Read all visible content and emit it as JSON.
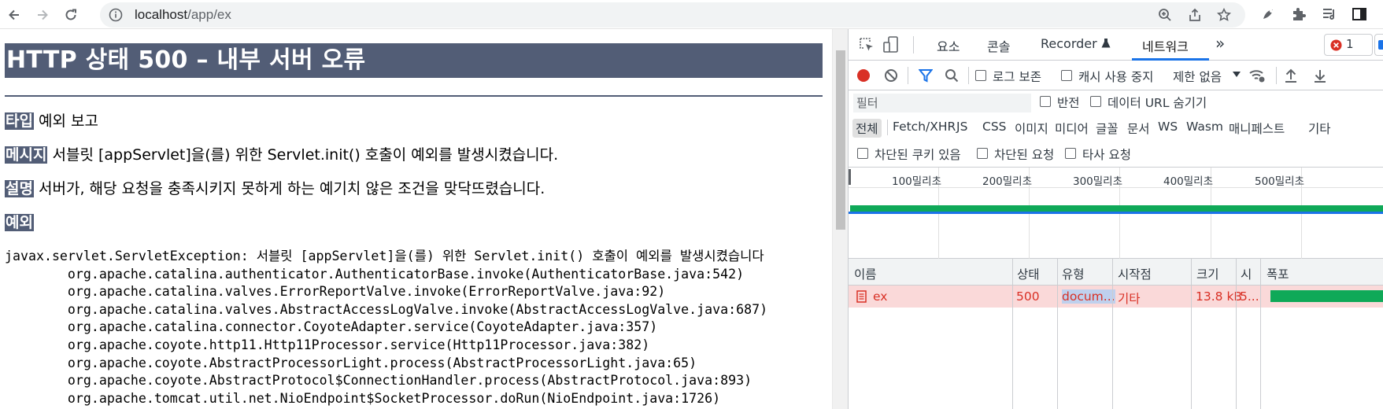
{
  "browser": {
    "url_host": "localhost",
    "url_path": "/app/ex"
  },
  "page": {
    "heading": "HTTP 상태 500 – 내부 서버 오류",
    "type_label": "타입",
    "type_value": "예외 보고",
    "message_label": "메시지",
    "message_value": "서블릿 [appServlet]을(를) 위한 Servlet.init() 호출이 예외를 발생시켰습니다.",
    "description_label": "설명",
    "description_value": "서버가, 해당 요청을 충족시키지 못하게 하는 예기치 않은 조건을 맞닥뜨렸습니다.",
    "exception_label": "예외",
    "stack_trace": [
      "javax.servlet.ServletException: 서블릿 [appServlet]을(를) 위한 Servlet.init() 호출이 예외를 발생시켰습니다",
      "\torg.apache.catalina.authenticator.AuthenticatorBase.invoke(AuthenticatorBase.java:542)",
      "\torg.apache.catalina.valves.ErrorReportValve.invoke(ErrorReportValve.java:92)",
      "\torg.apache.catalina.valves.AbstractAccessLogValve.invoke(AbstractAccessLogValve.java:687)",
      "\torg.apache.catalina.connector.CoyoteAdapter.service(CoyoteAdapter.java:357)",
      "\torg.apache.coyote.http11.Http11Processor.service(Http11Processor.java:382)",
      "\torg.apache.coyote.AbstractProcessorLight.process(AbstractProcessorLight.java:65)",
      "\torg.apache.coyote.AbstractProtocol$ConnectionHandler.process(AbstractProtocol.java:893)",
      "\torg.apache.tomcat.util.net.NioEndpoint$SocketProcessor.doRun(NioEndpoint.java:1726)"
    ]
  },
  "devtools": {
    "tabs": [
      "요소",
      "콘솔",
      "Recorder",
      "네트워크"
    ],
    "active_tab": "네트워크",
    "error_count": "1",
    "toolbar": {
      "preserve_log": "로그 보존",
      "disable_cache": "캐시 사용 중지",
      "throttling": "제한 없음"
    },
    "filter_placeholder": "필터",
    "invert": "반전",
    "hide_data_urls": "데이터 URL 숨기기",
    "type_filters": [
      "전체",
      "Fetch/XHR",
      "JS",
      "CSS",
      "이미지",
      "미디어",
      "글꼴",
      "문서",
      "WS",
      "Wasm",
      "매니페스트",
      "기타"
    ],
    "blocked_cookies": "차단된 쿠키 있음",
    "blocked_requests": "차단된 요청",
    "third_party": "타사 요청",
    "timeline_labels": [
      "100밀리초",
      "200밀리초",
      "300밀리초",
      "400밀리초",
      "500밀리초"
    ],
    "table": {
      "headers": [
        "이름",
        "상태",
        "유형",
        "시작점",
        "크기",
        "시",
        "폭포"
      ],
      "rows": [
        {
          "name": "ex",
          "status": "500",
          "type": "docum...",
          "initiator": "기타",
          "size": "13.8 kB",
          "time": "5..."
        }
      ]
    },
    "colors": {
      "error_row": "#fad9d9",
      "error_text": "#d93025",
      "accent": "#1a73e8",
      "tomcat_header": "#525d76"
    }
  }
}
